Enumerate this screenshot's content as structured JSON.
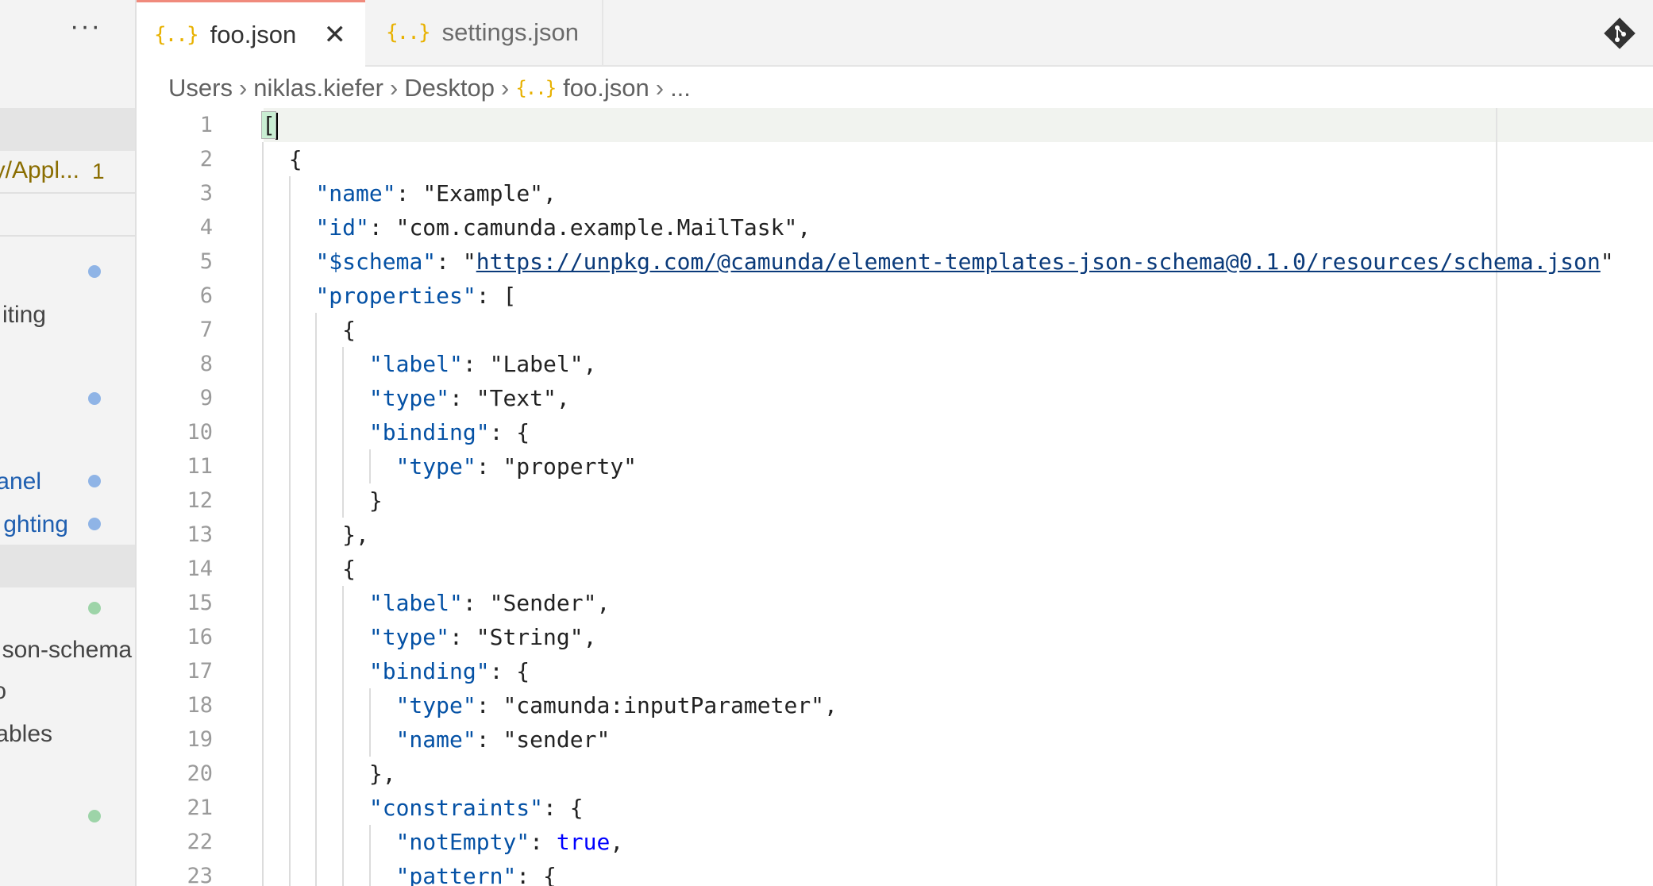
{
  "sidebar": {
    "more_label": "···",
    "items": [
      {
        "label": "y/Appl...",
        "color": "#8a6d00",
        "badge": "1"
      },
      {
        "label": "iting",
        "color": "#444444"
      },
      {
        "label": "anel",
        "color": "#1f5fb0"
      },
      {
        "label": "ghting",
        "color": "#1f5fb0"
      },
      {
        "label": "son-schema",
        "color": "#444444"
      },
      {
        "label": "o",
        "color": "#444444"
      },
      {
        "label": "ables",
        "color": "#444444"
      }
    ],
    "dot_colors": {
      "modified": "#8fb4e6",
      "added": "#9dd4a8"
    }
  },
  "tabs": [
    {
      "icon": "{..}",
      "label": "foo.json",
      "active": true,
      "close": "✕"
    },
    {
      "icon": "{..}",
      "label": "settings.json",
      "active": false
    }
  ],
  "breadcrumb": {
    "parts": [
      "Users",
      "niklas.kiefer",
      "Desktop"
    ],
    "file": "foo.json",
    "more": "...",
    "sep": "›"
  },
  "editor": {
    "line_numbers": [
      "1",
      "2",
      "3",
      "4",
      "5",
      "6",
      "7",
      "8",
      "9",
      "10",
      "11",
      "12",
      "13",
      "14",
      "15",
      "16",
      "17",
      "18",
      "19",
      "20",
      "21",
      "22",
      "23"
    ],
    "lines": [
      "[",
      "  {",
      "    \"name\": \"Example\",",
      "    \"id\": \"com.camunda.example.MailTask\",",
      "    \"$schema\": \"https://unpkg.com/@camunda/element-templates-json-schema@0.1.0/resources/schema.json\"",
      "    \"properties\": [",
      "      {",
      "        \"label\": \"Label\",",
      "        \"type\": \"Text\",",
      "        \"binding\": {",
      "          \"type\": \"property\"",
      "        }",
      "      },",
      "      {",
      "        \"label\": \"Sender\",",
      "        \"type\": \"String\",",
      "        \"binding\": {",
      "          \"type\": \"camunda:inputParameter\",",
      "          \"name\": \"sender\"",
      "        },",
      "        \"constraints\": {",
      "          \"notEmpty\": true,",
      "          \"pattern\": {"
    ]
  },
  "colors": {
    "key": "#0451a5",
    "string": "#222222",
    "url": "#0a3a7a",
    "boolean": "#0000ff",
    "active_tab_border": "#f08a7c",
    "json_icon": "#e8b100"
  }
}
